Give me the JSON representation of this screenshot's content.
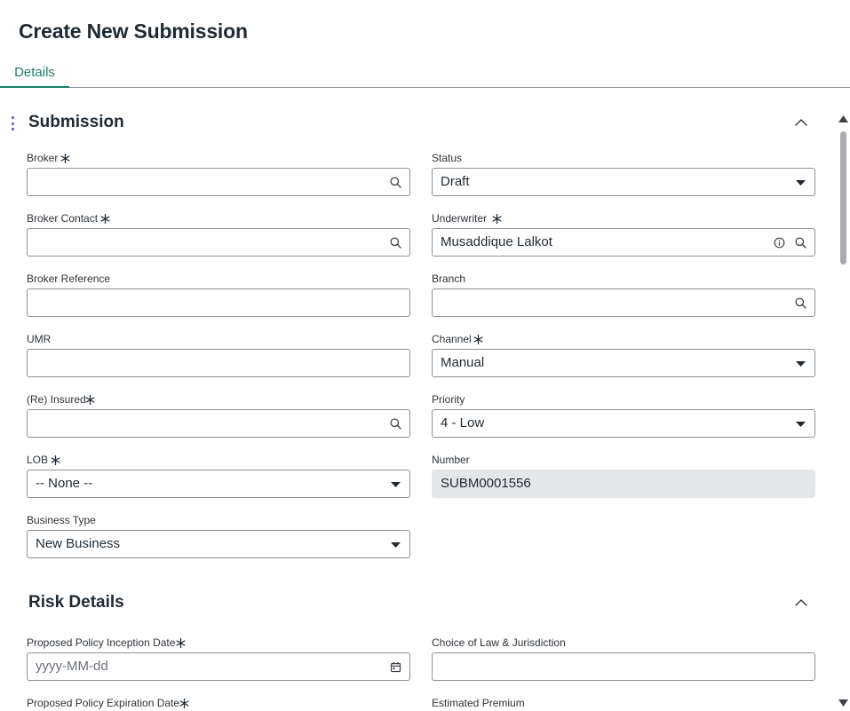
{
  "page": {
    "title": "Create New Submission"
  },
  "tabs": [
    {
      "label": "Details"
    }
  ],
  "sections": {
    "submission": {
      "title": "Submission",
      "fields": {
        "broker": {
          "label": "Broker",
          "value": ""
        },
        "status": {
          "label": "Status",
          "value": "Draft"
        },
        "broker_contact": {
          "label": "Broker Contact",
          "value": ""
        },
        "underwriter": {
          "label": "Underwriter",
          "value": "Musaddique Lalkot"
        },
        "broker_reference": {
          "label": "Broker Reference",
          "value": ""
        },
        "branch": {
          "label": "Branch",
          "value": ""
        },
        "umr": {
          "label": "UMR",
          "value": ""
        },
        "channel": {
          "label": "Channel",
          "value": "Manual"
        },
        "reinsured": {
          "label": "(Re) Insured",
          "value": ""
        },
        "priority": {
          "label": "Priority",
          "value": "4 - Low"
        },
        "lob": {
          "label": "LOB",
          "value": "-- None --"
        },
        "number": {
          "label": "Number",
          "value": "SUBM0001556"
        },
        "business_type": {
          "label": "Business Type",
          "value": "New Business"
        }
      }
    },
    "risk_details": {
      "title": "Risk Details",
      "fields": {
        "inception_date": {
          "label": "Proposed Policy Inception Date",
          "placeholder": "yyyy-MM-dd"
        },
        "choice_of_law": {
          "label": "Choice of Law & Jurisdiction",
          "value": ""
        },
        "expiration_date": {
          "label": "Proposed Policy Expiration Date"
        },
        "estimated_premium": {
          "label": "Estimated Premium"
        }
      }
    }
  },
  "icons": {
    "search": "search-icon",
    "info": "info-icon",
    "dropdown": "caret-down-icon",
    "calendar": "calendar-icon",
    "required": "asterisk-icon",
    "collapse": "chevron-up-icon",
    "drag": "drag-handle-icon"
  },
  "colors": {
    "accent": "#1a7f68",
    "required": "#1f2a33",
    "readonly_bg": "#e4e6e9",
    "drag_handle": "#4d5bd6"
  }
}
